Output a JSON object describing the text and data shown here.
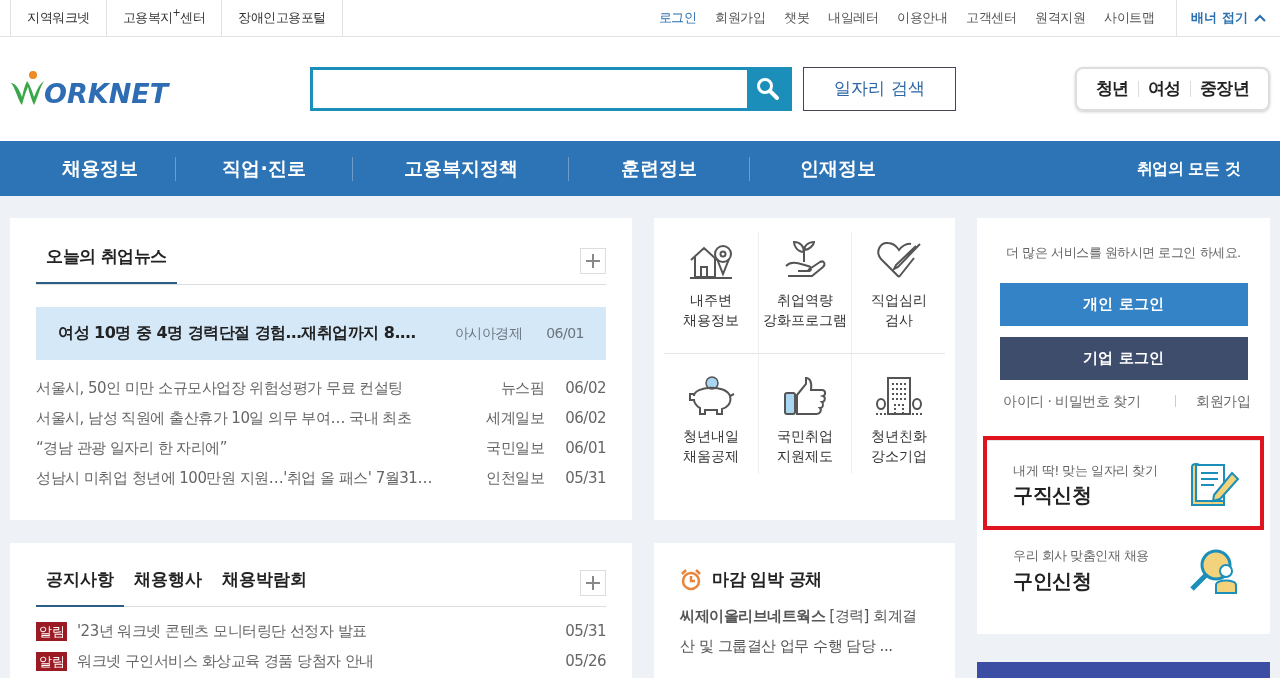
{
  "top_links_left": [
    "지역워크넷",
    "고용복지$^{+}$센터",
    "장애인고용포털"
  ],
  "top_links_right": [
    "로그인",
    "회원가입",
    "챗봇",
    "내일레터",
    "이용안내",
    "고객센터",
    "원격지원",
    "사이트맵"
  ],
  "banner_toggle": "배너 접기",
  "logo": "ORKNET",
  "search": {
    "button": "일자리 검색"
  },
  "audience": [
    "청년",
    "여성",
    "중장년"
  ],
  "nav": [
    "채용정보",
    "직업·진로",
    "고용복지정책",
    "훈련정보",
    "인재정보"
  ],
  "nav_right": "취업의 모든 것",
  "news": {
    "title": "오늘의 취업뉴스",
    "featured": {
      "title": "여성 10명 중 4명 경력단절 경험…재취업까지 8.…",
      "source": "아시아경제",
      "date": "06/01"
    },
    "items": [
      {
        "title": "서울시, 50인 미만 소규모사업장 위험성평가 무료 컨설팅",
        "source": "뉴스핌",
        "date": "06/02"
      },
      {
        "title": "서울시, 남성 직원에 출산휴가 10일 의무 부여… 국내 최초",
        "source": "세계일보",
        "date": "06/02"
      },
      {
        "title": "“경남 관광 일자리 한 자리에”",
        "source": "국민일보",
        "date": "06/01"
      },
      {
        "title": "성남시 미취업 청년에 100만원 지원…'취업 올 패스' 7월31…",
        "source": "인천일보",
        "date": "05/31"
      }
    ]
  },
  "services": [
    {
      "kind": "house",
      "lines": [
        "내주변",
        "채용정보"
      ]
    },
    {
      "kind": "sprout",
      "lines": [
        "취업역량",
        "강화프로그램"
      ]
    },
    {
      "kind": "heart",
      "lines": [
        "직업심리",
        "검사"
      ]
    },
    {
      "kind": "piggy",
      "lines": [
        "청년내일",
        "채움공제"
      ]
    },
    {
      "kind": "thumb",
      "lines": [
        "국민취업",
        "지원제도"
      ]
    },
    {
      "kind": "building",
      "lines": [
        "청년친화",
        "강소기업"
      ]
    }
  ],
  "login": {
    "message": "더 많은 서비스를 원하시면 로그인 하세요.",
    "buttons": [
      {
        "kind": "personal",
        "label": "개인 로그인"
      },
      {
        "kind": "corporate",
        "label": "기업 로그인"
      }
    ],
    "links": [
      "아이디 · 비밀번호 찾기",
      "회원가입"
    ]
  },
  "promos": [
    {
      "kind": "resume",
      "subtitle": "내게 딱! 맞는 일자리 찾기",
      "title": "구직신청",
      "highlighted": true
    },
    {
      "kind": "talent",
      "subtitle": "우리 회사 맞춤인재 채용",
      "title": "구인신청",
      "highlighted": false
    }
  ],
  "notices": {
    "tabs": [
      {
        "label": "공지사항",
        "selected": true
      },
      {
        "label": "채용행사",
        "selected": false
      },
      {
        "label": "채용박람회",
        "selected": false
      }
    ],
    "items": [
      {
        "tag": "알림",
        "title": "'23년 워크넷 콘텐츠 모니터링단 선정자 발표",
        "date": "05/31"
      },
      {
        "tag": "알림",
        "title": "워크넷 구인서비스 화상교육 경품 당첨자 안내",
        "date": "05/26"
      }
    ]
  },
  "deadline": {
    "title": "마감 임박 공채",
    "text": "**씨제이올리브네트웍스**  [경력] 회계결산 및 그룹결산 업무 수행 담당 ..."
  }
}
